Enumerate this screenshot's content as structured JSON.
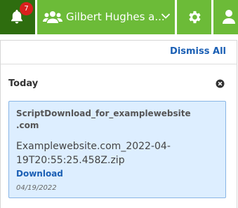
{
  "topbar": {
    "notification_count": "7",
    "user_name": "Gilbert Hughes a..."
  },
  "panel": {
    "dismiss_all": "Dismiss All",
    "section_title": "Today",
    "notification": {
      "title_line1": "ScriptDownload_for_examplewebsite",
      "title_line2": ".com",
      "file_line1": "Examplewebsite.com_2022-04-",
      "file_line2": "19T20:55:25.458Z.zip",
      "link_label": "Download",
      "date": "04/19/2022"
    }
  },
  "colors": {
    "brand_green": "#6cbb38",
    "active_green": "#2e6d0f",
    "badge_red": "#d9201d",
    "link_blue": "#1a5fb4",
    "card_bg": "#ddeeff"
  },
  "icons": [
    "bell-icon",
    "users-icon",
    "chevron-down-icon",
    "gear-icon",
    "person-icon",
    "close-icon"
  ]
}
